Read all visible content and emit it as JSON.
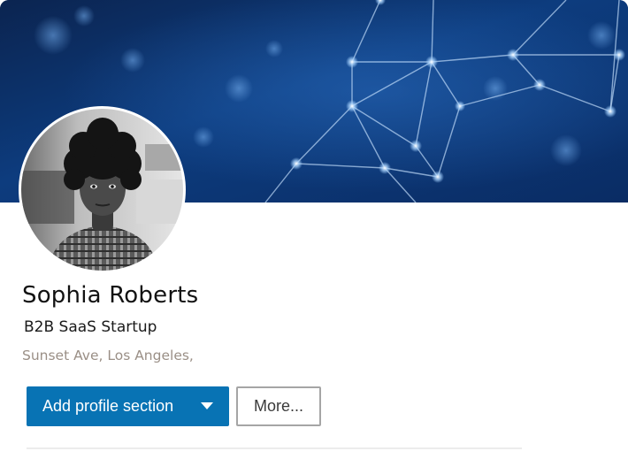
{
  "profile": {
    "name": "Sophia Roberts",
    "headline": "B2B SaaS Startup",
    "location": "Sunset Ave, Los Angeles,"
  },
  "actions": {
    "add_section_label": "Add profile section",
    "more_label": "More..."
  },
  "icons": {
    "dropdown": "chevron-down-icon"
  },
  "colors": {
    "primary_button": "#0873b4",
    "banner_base": "#0a2a5c",
    "location_text": "#9a8f86"
  }
}
